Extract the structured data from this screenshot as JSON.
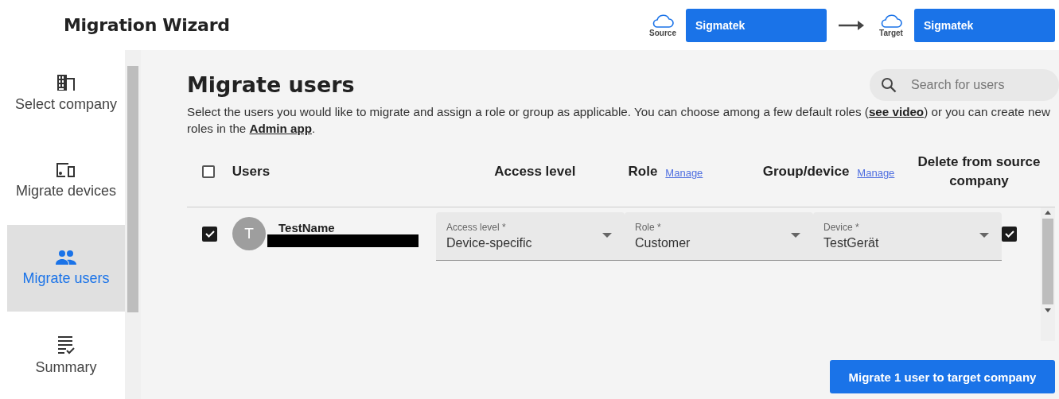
{
  "header": {
    "title": "Migration Wizard",
    "source": {
      "label": "Source",
      "company": "Sigmatek"
    },
    "target": {
      "label": "Target",
      "company": "Sigmatek"
    }
  },
  "sidebar": {
    "items": [
      {
        "kind": "company",
        "label": "Select company",
        "selected": false
      },
      {
        "kind": "devices",
        "label": "Migrate devices",
        "selected": false
      },
      {
        "kind": "users",
        "label": "Migrate users",
        "selected": true
      },
      {
        "kind": "summary",
        "label": "Summary",
        "selected": false
      }
    ]
  },
  "main": {
    "title": "Migrate users",
    "search": {
      "placeholder": "Search for users"
    },
    "description": {
      "before": "Select the users you would like to migrate and assign a role or group as applicable. You can choose among a few default roles (",
      "link1": "see video",
      "middle": ") or you can create new roles in the ",
      "link2": "Admin app",
      "after": "."
    },
    "table": {
      "select_all": {
        "checked": false
      },
      "columns": [
        {
          "label": "Users"
        },
        {
          "label": "Access level"
        },
        {
          "label": "Role",
          "link": "Manage"
        },
        {
          "label": "Group/device",
          "link": "Manage"
        },
        {
          "label": "Delete from source company"
        }
      ],
      "rows": [
        {
          "checked": true,
          "avatar": "T",
          "name": "TestName",
          "email_redacted": true,
          "fields": [
            {
              "label": "Access level *",
              "value": "Device-specific"
            },
            {
              "label": "Role *",
              "value": "Customer"
            },
            {
              "label": "Device *",
              "value": "TestGerät"
            }
          ],
          "delete": true
        }
      ]
    },
    "action": "Migrate 1 user to target company"
  }
}
